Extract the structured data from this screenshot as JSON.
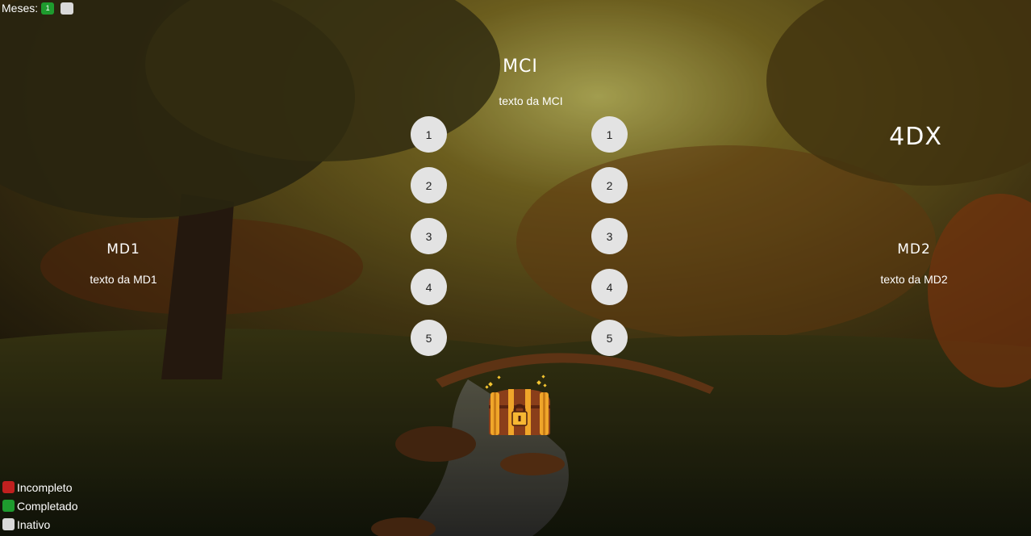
{
  "header": {
    "meses_label": "Meses:",
    "months": [
      {
        "label": "1",
        "state": "active"
      },
      {
        "label": "",
        "state": "inactive"
      }
    ]
  },
  "mci": {
    "title": "MCI",
    "text": "texto da MCI"
  },
  "dx": {
    "title": "4DX"
  },
  "md1": {
    "title": "MD1",
    "text": "texto da MD1"
  },
  "md2": {
    "title": "MD2",
    "text": "texto da MD2"
  },
  "columns": {
    "left": [
      "1",
      "2",
      "3",
      "4",
      "5"
    ],
    "right": [
      "1",
      "2",
      "3",
      "4",
      "5"
    ]
  },
  "chest": {
    "icon": "treasure-chest-icon"
  },
  "legend": [
    {
      "label": "Incompleto",
      "color": "#c0201f"
    },
    {
      "label": "Completado",
      "color": "#1e9b2e"
    },
    {
      "label": "Inativo",
      "color": "#d9d9d9"
    }
  ],
  "colors": {
    "active": "#1e9b2e",
    "inactive": "#d9d9d9",
    "circle": "#e3e3e3"
  }
}
